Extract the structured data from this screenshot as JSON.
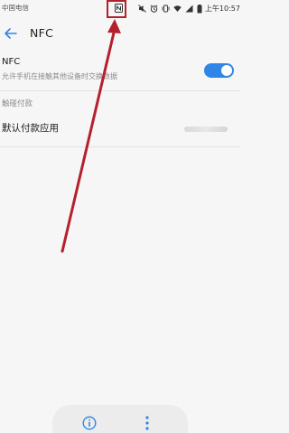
{
  "status_bar": {
    "carrier": "中国电信",
    "time": "上午10:57",
    "icons": [
      "nfc-icon",
      "mute-icon",
      "alarm-icon",
      "vibrate-icon",
      "wifi-icon",
      "signal-icon",
      "battery-icon"
    ]
  },
  "header": {
    "back_icon": "back-arrow-icon",
    "title": "NFC"
  },
  "nfc_setting": {
    "title": "NFC",
    "description": "允许手机在接触其他设备时交换数据",
    "enabled": true
  },
  "touch_pay_section": {
    "header": "触碰付款",
    "default_payment_label": "默认付款应用"
  },
  "bottom_bar": {
    "icons": [
      "info-icon",
      "more-vertical-icon"
    ]
  },
  "colors": {
    "accent": "#2f86e6",
    "annotation": "#b5202c",
    "background": "#f6f6f6"
  }
}
